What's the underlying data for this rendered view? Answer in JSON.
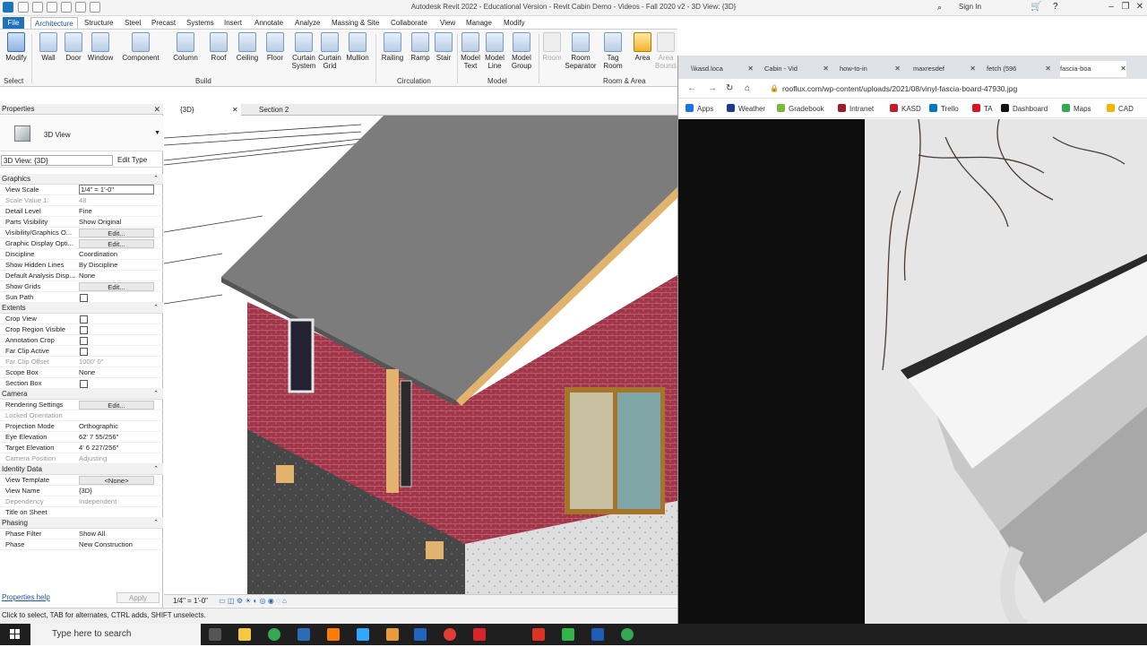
{
  "titlebar": {
    "title": "Autodesk Revit 2022 - Educational Version - Revit Cabin Demo - Videos - Fall 2020 v2 - 3D View: {3D}",
    "sign_in": "Sign In"
  },
  "ribbon": {
    "tabs": [
      "File",
      "Architecture",
      "Structure",
      "Steel",
      "Precast",
      "Systems",
      "Insert",
      "Annotate",
      "Analyze",
      "Massing & Site",
      "Collaborate",
      "View",
      "Manage",
      "Modify"
    ],
    "tools": [
      "Modify",
      "Wall",
      "Door",
      "Window",
      "Component",
      "Column",
      "Roof",
      "Ceiling",
      "Floor",
      "Curtain System",
      "Curtain Grid",
      "Mullion",
      "Railing",
      "Ramp",
      "Stair",
      "Model Text",
      "Model Line",
      "Model Group",
      "Room",
      "Room Separator",
      "Tag Room",
      "Area",
      "Area Boundary"
    ],
    "panels": {
      "select": "Select",
      "build": "Build",
      "circulation": "Circulation",
      "model": "Model",
      "room_area": "Room & Area"
    }
  },
  "properties": {
    "header": "Properties",
    "type_name": "3D View",
    "view_selector": "3D View: {3D}",
    "edit_type": "Edit Type",
    "groups": [
      {
        "name": "Graphics",
        "rows": [
          {
            "k": "View Scale",
            "v": "1/4\" = 1'-0\"",
            "t": "input"
          },
          {
            "k": "Scale Value    1:",
            "v": "48",
            "t": "dim"
          },
          {
            "k": "Detail Level",
            "v": "Fine"
          },
          {
            "k": "Parts Visibility",
            "v": "Show Original"
          },
          {
            "k": "Visibility/Graphics O...",
            "v": "Edit...",
            "t": "btn"
          },
          {
            "k": "Graphic Display Opti...",
            "v": "Edit...",
            "t": "btn"
          },
          {
            "k": "Discipline",
            "v": "Coordination"
          },
          {
            "k": "Show Hidden Lines",
            "v": "By Discipline"
          },
          {
            "k": "Default Analysis Disp...",
            "v": "None"
          },
          {
            "k": "Show Grids",
            "v": "Edit...",
            "t": "btn"
          },
          {
            "k": "Sun Path",
            "v": "",
            "t": "chk"
          }
        ]
      },
      {
        "name": "Extents",
        "rows": [
          {
            "k": "Crop View",
            "v": "",
            "t": "chk"
          },
          {
            "k": "Crop Region Visible",
            "v": "",
            "t": "chk"
          },
          {
            "k": "Annotation Crop",
            "v": "",
            "t": "chk"
          },
          {
            "k": "Far Clip Active",
            "v": "",
            "t": "chk"
          },
          {
            "k": "Far Clip Offset",
            "v": "1000'  0\"",
            "t": "dim"
          },
          {
            "k": "Scope Box",
            "v": "None"
          },
          {
            "k": "Section Box",
            "v": "",
            "t": "chk"
          }
        ]
      },
      {
        "name": "Camera",
        "rows": [
          {
            "k": "Rendering Settings",
            "v": "Edit...",
            "t": "btn"
          },
          {
            "k": "Locked Orientation",
            "v": "",
            "t": "dim"
          },
          {
            "k": "Projection Mode",
            "v": "Orthographic"
          },
          {
            "k": "Eye Elevation",
            "v": "62'  7 55/256\""
          },
          {
            "k": "Target Elevation",
            "v": "4'  6 227/256\""
          },
          {
            "k": "Camera Position",
            "v": "Adjusting",
            "t": "dim"
          }
        ]
      },
      {
        "name": "Identity Data",
        "rows": [
          {
            "k": "View Template",
            "v": "<None>",
            "t": "btn"
          },
          {
            "k": "View Name",
            "v": "{3D}"
          },
          {
            "k": "Dependency",
            "v": "Independent",
            "t": "dim"
          },
          {
            "k": "Title on Sheet",
            "v": ""
          }
        ]
      },
      {
        "name": "Phasing",
        "rows": [
          {
            "k": "Phase Filter",
            "v": "Show All"
          },
          {
            "k": "Phase",
            "v": "New Construction"
          }
        ]
      }
    ],
    "help": "Properties help",
    "apply": "Apply"
  },
  "viewtabs": [
    {
      "label": "{3D}"
    },
    {
      "label": "Section 2"
    }
  ],
  "view_control": {
    "scale": "1/4\" = 1'-0\""
  },
  "status": "Click to select, TAB for alternates, CTRL adds, SHIFT unselects.",
  "browser": {
    "tabs": [
      "\\\\kasd.loca",
      "Cabin - Vid",
      "how-to-in",
      "maxresdef",
      "fetch (596",
      "fascia-boa"
    ],
    "url": "rooflux.com/wp-content/uploads/2021/08/vinyl-fascia-board-47930.jpg",
    "bookmarks": [
      "Apps",
      "Weather",
      "Gradebook",
      "Intranet",
      "KASD",
      "Trello",
      "TA",
      "Dashboard",
      "Maps",
      "CAD"
    ]
  },
  "taskbar": {
    "search": "Type here to search"
  },
  "colors": {
    "brick": "#a0364a",
    "roof": "#7c7c7c",
    "accent": "#1e73be"
  }
}
